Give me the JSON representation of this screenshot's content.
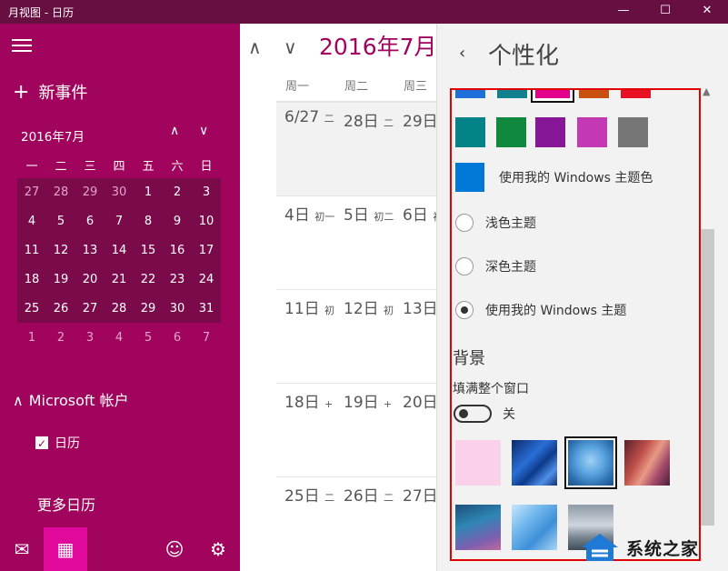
{
  "window": {
    "title": "月视图 - 日历",
    "minimize_glyph": "—",
    "maximize_glyph": "☐",
    "close_glyph": "✕"
  },
  "sidebar": {
    "new_event_plus": "+",
    "new_event_label": "新事件",
    "mini_calendar": {
      "title": "2016年7月",
      "up_glyph": "∧",
      "down_glyph": "∨",
      "weekdays": [
        "一",
        "二",
        "三",
        "四",
        "五",
        "六",
        "日"
      ],
      "weeks": [
        [
          "27",
          "28",
          "29",
          "30",
          "1",
          "2",
          "3"
        ],
        [
          "4",
          "5",
          "6",
          "7",
          "8",
          "9",
          "10"
        ],
        [
          "11",
          "12",
          "13",
          "14",
          "15",
          "16",
          "17"
        ],
        [
          "18",
          "19",
          "20",
          "21",
          "22",
          "23",
          "24"
        ],
        [
          "25",
          "26",
          "27",
          "28",
          "29",
          "30",
          "31"
        ],
        [
          "1",
          "2",
          "3",
          "4",
          "5",
          "6",
          "7"
        ]
      ]
    },
    "account_chevron": "∧",
    "account_label": "Microsoft 帐户",
    "calendar_check": "✓",
    "calendar_item_label": "日历",
    "more_calendars": "更多日历",
    "bottom_icons": {
      "mail": "✉",
      "calendar": "▦",
      "feedback": "☺",
      "settings": "⚙"
    }
  },
  "main": {
    "nav_up": "∧",
    "nav_down": "∨",
    "month_title": "2016年7月",
    "weekday_headers": [
      "周一",
      "周二",
      "周三"
    ],
    "weeks": [
      [
        {
          "day": "6/27",
          "lunar": "二"
        },
        {
          "day": "28日",
          "lunar": "二"
        },
        {
          "day": "29日",
          "lunar": "二"
        }
      ],
      [
        {
          "day": "4日",
          "lunar": "初一"
        },
        {
          "day": "5日",
          "lunar": "初二"
        },
        {
          "day": "6日",
          "lunar": "初"
        }
      ],
      [
        {
          "day": "11日",
          "lunar": "初"
        },
        {
          "day": "12日",
          "lunar": "初"
        },
        {
          "day": "13日",
          "lunar": ""
        }
      ],
      [
        {
          "day": "18日",
          "lunar": "+"
        },
        {
          "day": "19日",
          "lunar": "+"
        },
        {
          "day": "20日",
          "lunar": ""
        }
      ],
      [
        {
          "day": "25日",
          "lunar": "二"
        },
        {
          "day": "26日",
          "lunar": "二"
        },
        {
          "day": "27日",
          "lunar": ""
        }
      ]
    ]
  },
  "personalize": {
    "back_glyph": "‹",
    "title": "个性化",
    "scroll_up_glyph": "▲",
    "accent_colors_top": [
      "#1e6fd9",
      "#10808e",
      "#e3008c",
      "#ca5010",
      "#e81123"
    ],
    "accent_colors": [
      "#038387",
      "#10893e",
      "#881798",
      "#c239b3",
      "#767676"
    ],
    "windows_accent_color": "#0078d7",
    "use_windows_accent_label": "使用我的 Windows 主题色",
    "theme_options": [
      {
        "label": "浅色主题",
        "selected": false
      },
      {
        "label": "深色主题",
        "selected": false
      },
      {
        "label": "使用我的 Windows 主题",
        "selected": true
      }
    ],
    "background_heading": "背景",
    "fill_window_label": "填满整个窗口",
    "fill_window_state": "关",
    "background_thumbnails": [
      "pink",
      "blue-streaks",
      "blue-tree",
      "red-canyon",
      "teal-wave",
      "blue-geometric",
      "misty-lake"
    ]
  },
  "watermark": {
    "text": "系统之家"
  }
}
